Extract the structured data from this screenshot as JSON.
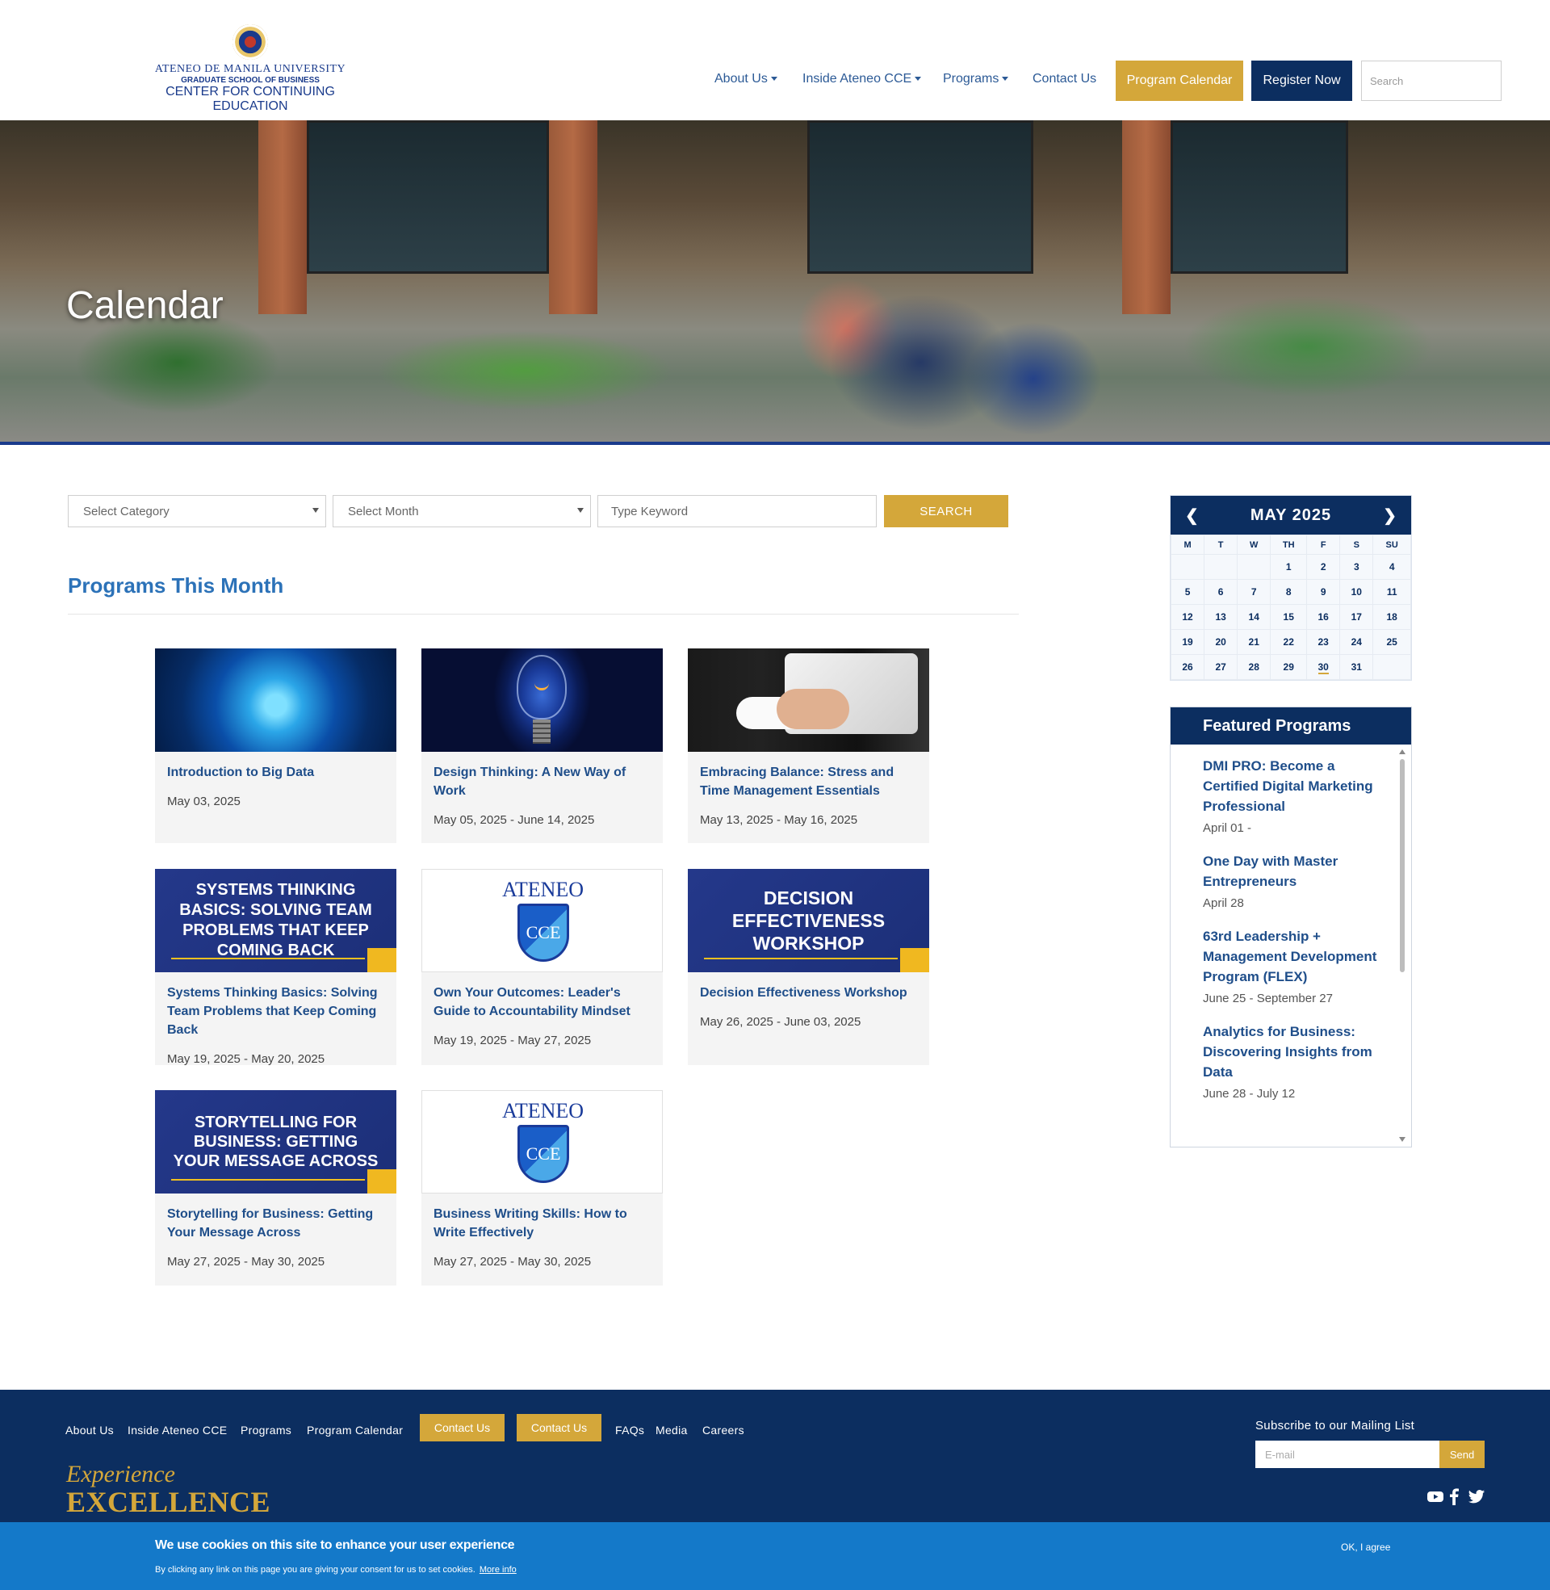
{
  "header": {
    "logo": {
      "line1": "ATENEO DE MANILA UNIVERSITY",
      "line2": "GRADUATE SCHOOL OF BUSINESS",
      "line3": "CENTER FOR CONTINUING EDUCATION"
    },
    "nav": {
      "about": "About Us",
      "inside": "Inside Ateneo CCE",
      "programs": "Programs",
      "contact": "Contact Us",
      "program_calendar": "Program Calendar",
      "register": "Register Now",
      "search_placeholder": "Search"
    }
  },
  "hero": {
    "title": "Calendar"
  },
  "filters": {
    "category": "Select Category",
    "month": "Select Month",
    "keyword_placeholder": "Type Keyword",
    "search_label": "SEARCH"
  },
  "section": {
    "title": "Programs This Month"
  },
  "cards": [
    {
      "title": "Introduction to Big Data",
      "date": "May 03, 2025"
    },
    {
      "title": "Design Thinking: A New Way of Work",
      "date": "May 05, 2025 - June 14, 2025"
    },
    {
      "title": "Embracing Balance: Stress and Time Management Essentials",
      "date": "May 13, 2025 - May 16, 2025"
    },
    {
      "title": "Systems Thinking Basics: Solving Team Problems that Keep Coming Back",
      "date": "May 19, 2025 - May 20, 2025",
      "banner": "SYSTEMS THINKING BASICS: SOLVING TEAM PROBLEMS THAT KEEP COMING BACK"
    },
    {
      "title": "Own Your Outcomes: Leader's Guide to Accountability Mindset",
      "date": "May 19, 2025 - May 27, 2025",
      "logo_word": "ATENEO",
      "logo_mark": "CCE"
    },
    {
      "title": "Decision Effectiveness Workshop",
      "date": "May 26, 2025 - June 03, 2025",
      "banner": "DECISION EFFECTIVENESS WORKSHOP"
    },
    {
      "title": "Storytelling for Business: Getting Your Message Across",
      "date": "May 27, 2025 - May 30, 2025",
      "banner": "STORYTELLING FOR BUSINESS: GETTING YOUR MESSAGE ACROSS"
    },
    {
      "title": "Business Writing Skills: How to Write Effectively",
      "date": "May 27, 2025 - May 30, 2025",
      "logo_word": "ATENEO",
      "logo_mark": "CCE"
    }
  ],
  "calendar": {
    "title": "MAY 2025",
    "prev": "❮",
    "next": "❯",
    "weekdays": [
      "M",
      "T",
      "W",
      "TH",
      "F",
      "S",
      "SU"
    ],
    "weeks": [
      [
        "",
        "",
        "",
        "1",
        "2",
        "3",
        "4"
      ],
      [
        "5",
        "6",
        "7",
        "8",
        "9",
        "10",
        "11"
      ],
      [
        "12",
        "13",
        "14",
        "15",
        "16",
        "17",
        "18"
      ],
      [
        "19",
        "20",
        "21",
        "22",
        "23",
        "24",
        "25"
      ],
      [
        "26",
        "27",
        "28",
        "29",
        "30",
        "31",
        ""
      ]
    ],
    "today": "30"
  },
  "featured": {
    "title": "Featured Programs",
    "items": [
      {
        "title": "DMI PRO: Become a Certified Digital Marketing Professional",
        "date": "April 01 -"
      },
      {
        "title": "One Day with Master Entrepreneurs",
        "date": "April 28"
      },
      {
        "title": "63rd Leadership + Management Development Program (FLEX)",
        "date": "June 25 - September 27"
      },
      {
        "title": "Analytics for Business: Discovering Insights from Data",
        "date": "June 28 - July 12"
      }
    ]
  },
  "footer": {
    "links": {
      "about": "About Us",
      "inside": "Inside Ateneo CCE",
      "programs": "Programs",
      "program_calendar": "Program Calendar",
      "contact1": "Contact Us",
      "contact2": "Contact Us",
      "faqs": "FAQs",
      "media": "Media",
      "careers": "Careers"
    },
    "tagline1": "Experience",
    "tagline2": "EXCELLENCE",
    "subscribe_label": "Subscribe to our Mailing List",
    "email_placeholder": "E-mail",
    "send_label": "Send",
    "social_icons": [
      "youtube-icon",
      "facebook-icon",
      "twitter-icon"
    ]
  },
  "cookie": {
    "heading": "We use cookies on this site to enhance your user experience",
    "text": "By clicking any link on this page you are giving your consent for us to set cookies.",
    "more": "More info",
    "ok": "OK, I agree"
  },
  "colors": {
    "navy": "#0c2e60",
    "gold": "#d4a73a",
    "link_blue": "#2c72b8",
    "cookie_blue": "#1479c9"
  }
}
